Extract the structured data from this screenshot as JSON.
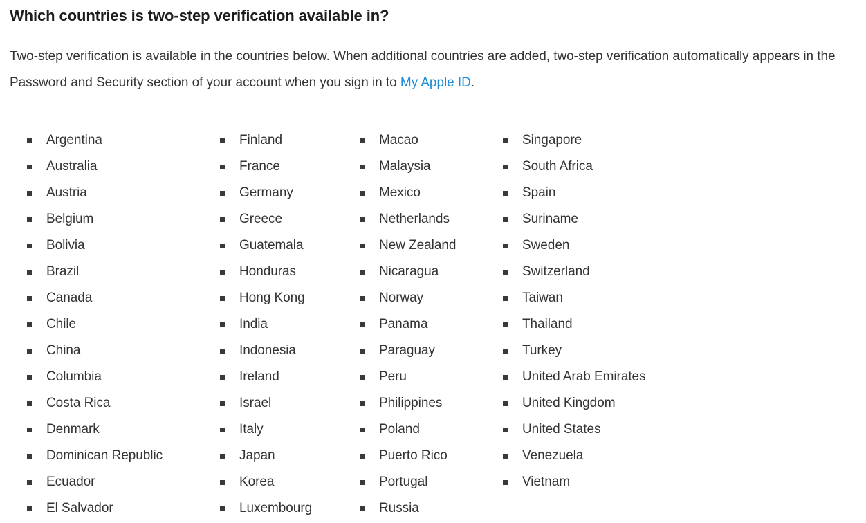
{
  "page": {
    "title": "Which countries is two-step verification available in?"
  },
  "intro": {
    "text_before_link": "Two-step verification is available in the countries below. When additional countries are added, two-step verification automatically appears in the Password and Security section of your account when you sign in to ",
    "link_label": "My Apple ID",
    "text_after_link": ".",
    "link_color": "#1a8cd8"
  },
  "colors": {
    "text": "#333333",
    "heading": "#1d1d1d",
    "bullet": "#3a3a3a",
    "link": "#1a8cd8",
    "background": "#ffffff"
  },
  "columns": [
    {
      "name": "column-1",
      "items": [
        "Argentina",
        "Australia",
        "Austria",
        "Belgium",
        "Bolivia",
        "Brazil",
        "Canada",
        "Chile",
        "China",
        "Columbia",
        "Costa Rica",
        "Denmark",
        "Dominican Republic",
        "Ecuador",
        "El Salvador"
      ]
    },
    {
      "name": "column-2",
      "items": [
        "Finland",
        "France",
        "Germany",
        "Greece",
        "Guatemala",
        "Honduras",
        "Hong Kong",
        "India",
        "Indonesia",
        "Ireland",
        "Israel",
        "Italy",
        "Japan",
        "Korea",
        "Luxembourg"
      ]
    },
    {
      "name": "column-3",
      "items": [
        "Macao",
        "Malaysia",
        "Mexico",
        "Netherlands",
        "New Zealand",
        "Nicaragua",
        "Norway",
        "Panama",
        "Paraguay",
        "Peru",
        "Philippines",
        "Poland",
        "Puerto Rico",
        "Portugal",
        "Russia"
      ]
    },
    {
      "name": "column-4",
      "items": [
        "Singapore",
        "South Africa",
        "Spain",
        "Suriname",
        "Sweden",
        "Switzerland",
        "Taiwan",
        "Thailand",
        "Turkey",
        "United Arab Emirates",
        "United Kingdom",
        "United States",
        "Venezuela",
        "Vietnam"
      ]
    }
  ]
}
